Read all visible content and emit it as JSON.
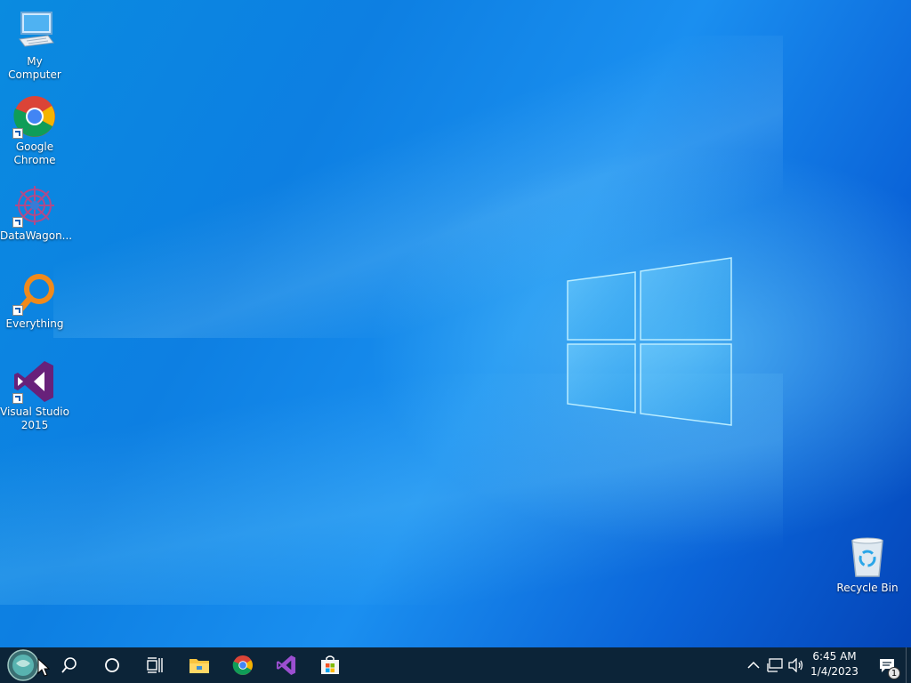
{
  "desktop": {
    "icons": [
      {
        "label": "My Computer",
        "icon": "computer-icon"
      },
      {
        "label": "Google Chrome",
        "icon": "chrome-icon"
      },
      {
        "label": "DataWagon...",
        "icon": "datawagon-icon"
      },
      {
        "label": "Everything",
        "icon": "everything-search-icon"
      },
      {
        "label": "Visual Studio 2015",
        "icon": "visual-studio-icon"
      },
      {
        "label": "Recycle Bin",
        "icon": "recycle-bin-icon"
      }
    ]
  },
  "taskbar": {
    "start": {
      "icon": "start-orb-icon"
    },
    "search": {
      "icon": "search-icon"
    },
    "cortana": {
      "icon": "cortana-circle-icon"
    },
    "taskview": {
      "icon": "task-view-icon"
    },
    "pinned": [
      {
        "name": "File Explorer",
        "icon": "folder-icon"
      },
      {
        "name": "Google Chrome",
        "icon": "chrome-icon"
      },
      {
        "name": "Visual Studio",
        "icon": "visual-studio-icon"
      },
      {
        "name": "Microsoft Store",
        "icon": "store-icon"
      }
    ],
    "tray": {
      "chevron_icon": "chevron-up-icon",
      "network_icon": "network-icon",
      "volume_icon": "volume-icon",
      "time": "6:45 AM",
      "date": "1/4/2023",
      "notification_count": "1"
    }
  },
  "colors": {
    "taskbar_bg": "#0c2438",
    "desktop_accent": "#0a8be0",
    "vs_purple": "#68217a"
  }
}
